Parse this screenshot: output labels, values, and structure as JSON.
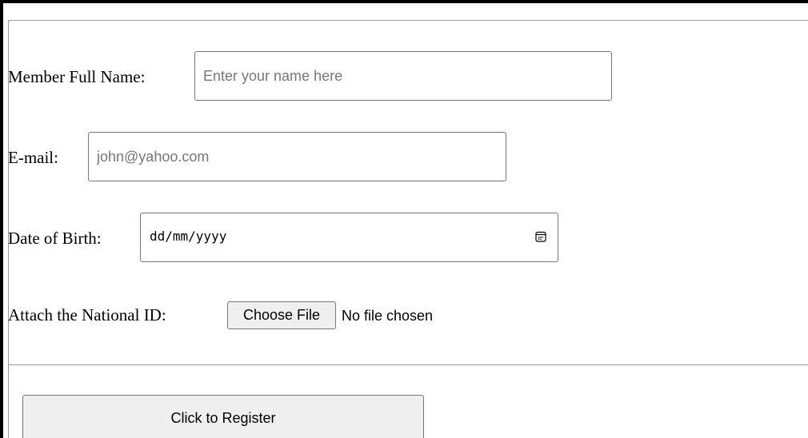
{
  "form": {
    "full_name": {
      "label": "Member Full Name:",
      "placeholder": "Enter your name here",
      "value": ""
    },
    "email": {
      "label": "E-mail:",
      "placeholder": "john@yahoo.com",
      "value": ""
    },
    "dob": {
      "label": "Date of Birth:",
      "display": "dd/mm/yyyy",
      "icon": "calendar-icon"
    },
    "national_id": {
      "label": "Attach the National ID:",
      "button_label": "Choose File",
      "status": "No file chosen"
    },
    "submit": {
      "label": "Click to Register"
    }
  },
  "colors": {
    "border": "#767676",
    "button_bg": "#efefef",
    "placeholder": "#767676",
    "rule": "#9a9a9a"
  }
}
